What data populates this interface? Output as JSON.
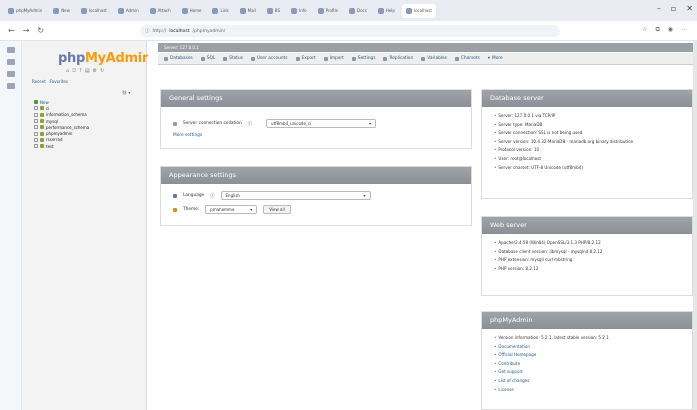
{
  "browser": {
    "tabs": [
      {
        "label": "phpMyAdmin"
      },
      {
        "label": "New"
      },
      {
        "label": "localhost"
      },
      {
        "label": "Admin"
      },
      {
        "label": "Attach"
      },
      {
        "label": "Home"
      },
      {
        "label": "Link"
      },
      {
        "label": "Mail"
      },
      {
        "label": "BS"
      },
      {
        "label": "Info"
      },
      {
        "label": "Profile"
      },
      {
        "label": "Docs"
      },
      {
        "label": "Help"
      },
      {
        "label": "localhost"
      }
    ],
    "url_prefix": "http://",
    "url_host": "localhost",
    "url_path": "/phpmyadmin/"
  },
  "navigation": {
    "logo_php": "php",
    "logo_myadmin": "MyAdmin",
    "links": [
      "Recent",
      "Favorites"
    ],
    "tools_label": "⛓ ▾",
    "tree": [
      {
        "label": "New",
        "type": "new"
      },
      {
        "label": "ci",
        "type": "db"
      },
      {
        "label": "information_schema",
        "type": "db"
      },
      {
        "label": "mysql",
        "type": "db"
      },
      {
        "label": "performance_schema",
        "type": "db"
      },
      {
        "label": "phpmyadmin",
        "type": "db"
      },
      {
        "label": "rsserrad",
        "type": "db"
      },
      {
        "label": "test",
        "type": "db"
      }
    ]
  },
  "main": {
    "server_label": "Server: 127.0.0.1",
    "menu": [
      {
        "label": "Databases"
      },
      {
        "label": "SQL"
      },
      {
        "label": "Status"
      },
      {
        "label": "User accounts"
      },
      {
        "label": "Export"
      },
      {
        "label": "Import"
      },
      {
        "label": "Settings"
      },
      {
        "label": "Replication"
      },
      {
        "label": "Variables"
      },
      {
        "label": "Charsets"
      },
      {
        "label": "More"
      }
    ],
    "general_settings": {
      "title": "General settings",
      "collation_label": "Server connection collation",
      "collation_value": "utf8mb4_unicode_ci",
      "more_settings": "More settings"
    },
    "appearance_settings": {
      "title": "Appearance settings",
      "language_label": "Language",
      "language_value": "English",
      "theme_label": "Theme:",
      "theme_value": "pmahomme",
      "view_all": "View all"
    },
    "database_server": {
      "title": "Database server",
      "items": [
        "Server: 127.0.0.1 via TCP/IP",
        "Server type: MariaDB",
        "Server connection: SSL is not being used",
        "Server version: 10.4.32-MariaDB - mariadb.org binary distribution",
        "Protocol version: 10",
        "User: root@localhost",
        "Server charset: UTF-8 Unicode (utf8mb4)"
      ]
    },
    "web_server": {
      "title": "Web server",
      "items": [
        "Apache/2.4.58 (Win64) OpenSSL/3.1.3 PHP/8.2.12",
        "Database client version: libmysql - mysqlnd 8.2.12",
        "PHP extension: mysqli  curl  mbstring",
        "PHP version: 8.2.12"
      ]
    },
    "phpmyadmin_panel": {
      "title": "phpMyAdmin",
      "version": "Version information: 5.2.1, latest stable version: 5.2.1",
      "links": [
        "Documentation",
        "Official Homepage",
        "Contribute",
        "Get support",
        "List of changes",
        "License"
      ]
    }
  }
}
